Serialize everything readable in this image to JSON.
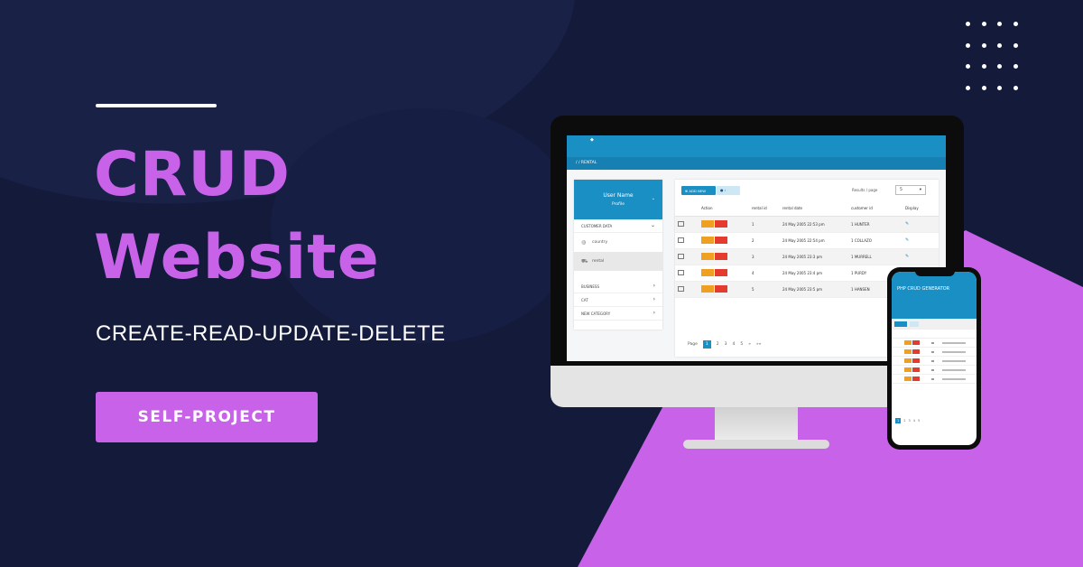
{
  "hero": {
    "title_line1": "CRUD",
    "title_line2": "Website",
    "subtitle": "CREATE-READ-UPDATE-DELETE",
    "cta_label": "SELF-PROJECT"
  },
  "colors": {
    "background": "#131a3a",
    "accent": "#c762e9",
    "app_blue": "#1a8fc4"
  },
  "desktop_app": {
    "breadcrumb": "/   /   RENTAL",
    "sidebar": {
      "user_name": "User Name",
      "profile": "Profile",
      "section_customer": "CUSTOMER DATA",
      "items": [
        {
          "label": "country",
          "icon": "globe-icon"
        },
        {
          "label": "rental",
          "icon": "cart-icon"
        }
      ],
      "sections": [
        "BUSINESS",
        "CAT",
        "NEW CATEGORY"
      ]
    },
    "toolbar": {
      "add_label": "ADD NEW",
      "results_label": "Results / page",
      "results_value": "5"
    },
    "table": {
      "headers": [
        "",
        "Action",
        "rental id",
        "rental date",
        "customer id",
        "Display"
      ],
      "rows": [
        {
          "id": "1",
          "date": "24 May 2005 22:53 pm",
          "customer": "1 HUNTER"
        },
        {
          "id": "2",
          "date": "24 May 2005 22:54 pm",
          "customer": "1 COLLAZO"
        },
        {
          "id": "3",
          "date": "24 May 2005 23:3 pm",
          "customer": "1 MURRELL"
        },
        {
          "id": "4",
          "date": "24 May 2005 23:4 pm",
          "customer": "1 PURDY"
        },
        {
          "id": "5",
          "date": "24 May 2005 23:5 pm",
          "customer": "1 HANSEN"
        }
      ]
    },
    "pager": {
      "label": "Page",
      "pages": [
        "1",
        "2",
        "3",
        "4",
        "5"
      ],
      "next": "»",
      "last": "»»",
      "results": "Results 1"
    }
  },
  "mobile_app": {
    "title": "PHP CRUD GENERATOR"
  }
}
